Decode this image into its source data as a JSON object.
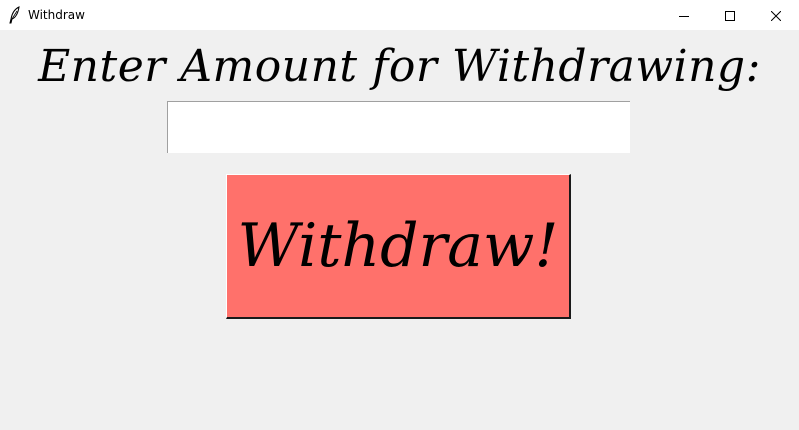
{
  "window": {
    "title": "Withdraw",
    "icons": {
      "app": "feather-icon",
      "minimize": "minimize-icon",
      "maximize": "maximize-icon",
      "close": "close-icon"
    }
  },
  "main": {
    "heading": "Enter Amount for Withdrawing:",
    "amount_input": {
      "value": "",
      "placeholder": ""
    },
    "withdraw_button_label": "Withdraw!"
  },
  "colors": {
    "background": "#f0f0f0",
    "titlebar": "#ffffff",
    "button": "#ff716b",
    "input": "#ffffff"
  }
}
